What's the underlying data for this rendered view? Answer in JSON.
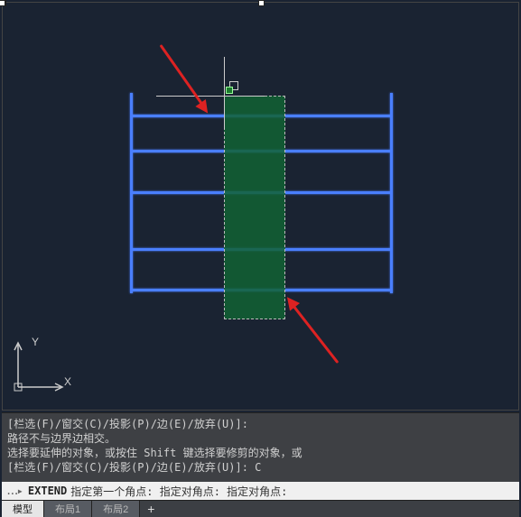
{
  "ucs": {
    "x_label": "X",
    "y_label": "Y"
  },
  "cmd": {
    "line1": "[栏选(F)/窗交(C)/投影(P)/边(E)/放弃(U)]:",
    "line2": "路径不与边界边相交。",
    "line3": "选择要延伸的对象，或按住 Shift 键选择要修剪的对象，或",
    "line4": "[栏选(F)/窗交(C)/投影(P)/边(E)/放弃(U)]:   C"
  },
  "input": {
    "keyword": "EXTEND",
    "prompt": "指定第一个角点: 指定对角点: 指定对角点:"
  },
  "tabs": {
    "model": "模型",
    "layout1": "布局1",
    "layout2": "布局2",
    "add": "+"
  }
}
